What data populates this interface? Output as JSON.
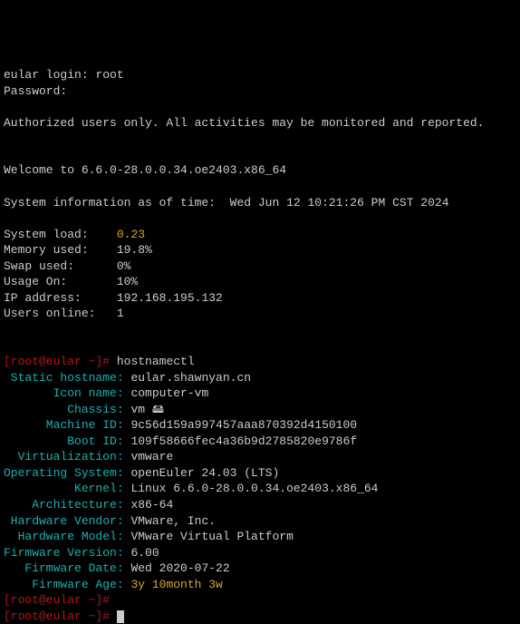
{
  "login": {
    "prompt": "eular login:",
    "user": "root",
    "password_label": "Password:"
  },
  "auth_message": "Authorized users only. All activities may be monitored and reported.",
  "welcome": "Welcome to 6.6.0-28.0.0.34.oe2403.x86_64",
  "sysinfo_header_prefix": "System information as of time:",
  "sysinfo_time": "Wed Jun 12 10:21:26 PM CST 2024",
  "metrics": {
    "system_load_label": "System load:",
    "system_load_value": "0.23",
    "memory_used_label": "Memory used:",
    "memory_used_value": "19.8%",
    "swap_used_label": "Swap used:",
    "swap_used_value": "0%",
    "usage_on_label": "Usage On:",
    "usage_on_value": "10%",
    "ip_label": "IP address:",
    "ip_value": "192.168.195.132",
    "users_label": "Users online:",
    "users_value": "1"
  },
  "prompt1": {
    "full": "[root@eular ~]#",
    "command": "hostnamectl"
  },
  "hostnamectl": {
    "static_hostname_label": " Static hostname:",
    "static_hostname_value": "eular.shawnyan.cn",
    "icon_name_label": "       Icon name:",
    "icon_name_value": "computer-vm",
    "chassis_label": "         Chassis:",
    "chassis_value": "vm 🖴",
    "machine_id_label": "      Machine ID:",
    "machine_id_value": "9c56d159a997457aaa870392d4150100",
    "boot_id_label": "         Boot ID:",
    "boot_id_value": "109f58666fec4a36b9d2785820e9786f",
    "virtualization_label": "  Virtualization:",
    "virtualization_value": "vmware",
    "os_label": "Operating System:",
    "os_value": "openEuler 24.03 (LTS)",
    "kernel_label": "          Kernel:",
    "kernel_value": "Linux 6.6.0-28.0.0.34.oe2403.x86_64",
    "arch_label": "    Architecture:",
    "arch_value": "x86-64",
    "hw_vendor_label": " Hardware Vendor:",
    "hw_vendor_value": "VMware, Inc.",
    "hw_model_label": "  Hardware Model:",
    "hw_model_value": "VMware Virtual Platform",
    "fw_version_label": "Firmware Version:",
    "fw_version_value": "6.00",
    "fw_date_label": "   Firmware Date:",
    "fw_date_value": "Wed 2020-07-22",
    "fw_age_label": "    Firmware Age:",
    "fw_age_value": "3y 10month 3w"
  },
  "prompt2": "[root@eular ~]#",
  "prompt3": "[root@eular ~]#"
}
